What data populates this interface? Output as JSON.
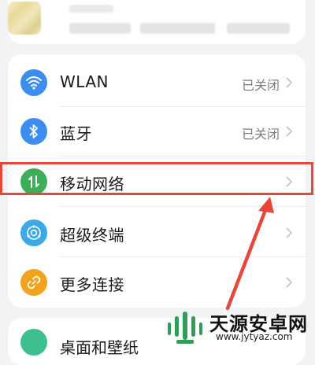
{
  "settings": {
    "items": [
      {
        "label": "WLAN",
        "status": "已关闭",
        "icon": "wifi-icon",
        "color": "#3b8ef0"
      },
      {
        "label": "蓝牙",
        "status": "已关闭",
        "icon": "bluetooth-icon",
        "color": "#3b8ef0"
      },
      {
        "label": "移动网络",
        "status": "",
        "icon": "mobile-data-icon",
        "color": "#3cae5a"
      },
      {
        "label": "超级终端",
        "status": "",
        "icon": "super-device-icon",
        "color": "#39a9e8"
      },
      {
        "label": "更多连接",
        "status": "",
        "icon": "link-icon",
        "color": "#f2a21b"
      }
    ]
  },
  "next_section": {
    "label": "桌面和壁纸"
  },
  "watermark": {
    "brand": "天源安卓网",
    "url": "www.jytyaz.com"
  },
  "colors": {
    "highlight": "#e7473b",
    "arrow": "#e7473b"
  }
}
